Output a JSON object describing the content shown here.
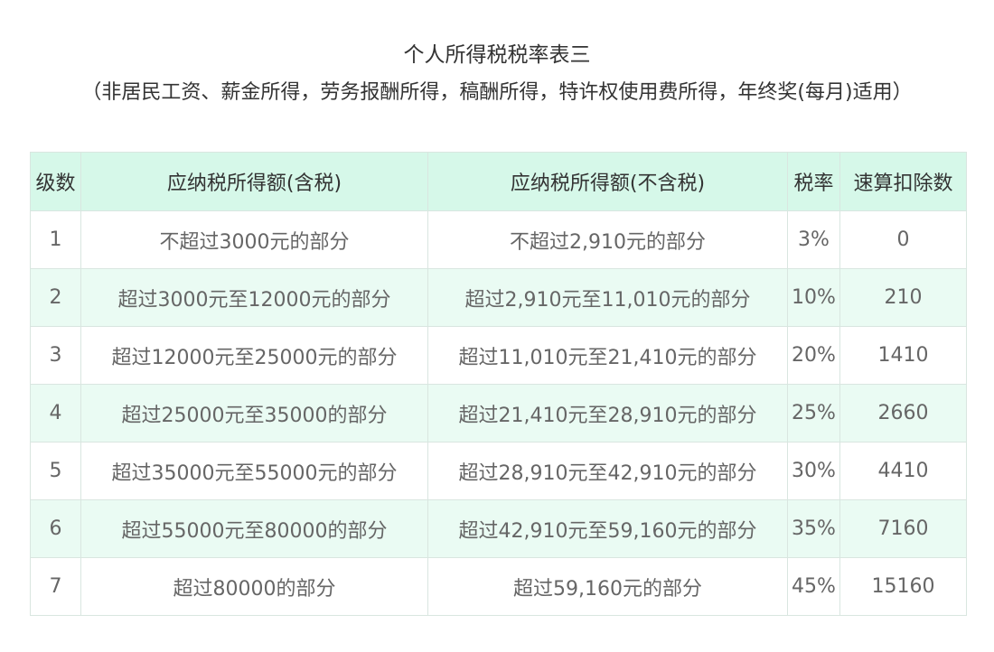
{
  "title": "个人所得税税率表三",
  "subtitle": "（非居民工资、薪金所得，劳务报酬所得，稿酬所得，特许权使用费所得，年终奖(每月)适用）",
  "table": {
    "headers": [
      "级数",
      "应纳税所得额(含税)",
      "应纳税所得额(不含税)",
      "税率",
      "速算扣除数"
    ],
    "rows": [
      [
        "1",
        "不超过3000元的部分",
        "不超过2,910元的部分",
        "3%",
        "0"
      ],
      [
        "2",
        "超过3000元至12000元的部分",
        "超过2,910元至11,010元的部分",
        "10%",
        "210"
      ],
      [
        "3",
        "超过12000元至25000元的部分",
        "超过11,010元至21,410元的部分",
        "20%",
        "1410"
      ],
      [
        "4",
        "超过25000元至35000的部分",
        "超过21,410元至28,910元的部分",
        "25%",
        "2660"
      ],
      [
        "5",
        "超过35000元至55000元的部分",
        "超过28,910元至42,910元的部分",
        "30%",
        "4410"
      ],
      [
        "6",
        "超过55000元至80000的部分",
        "超过42,910元至59,160元的部分",
        "35%",
        "7160"
      ],
      [
        "7",
        "超过80000的部分",
        "超过59,160元的部分",
        "45%",
        "15160"
      ]
    ]
  }
}
